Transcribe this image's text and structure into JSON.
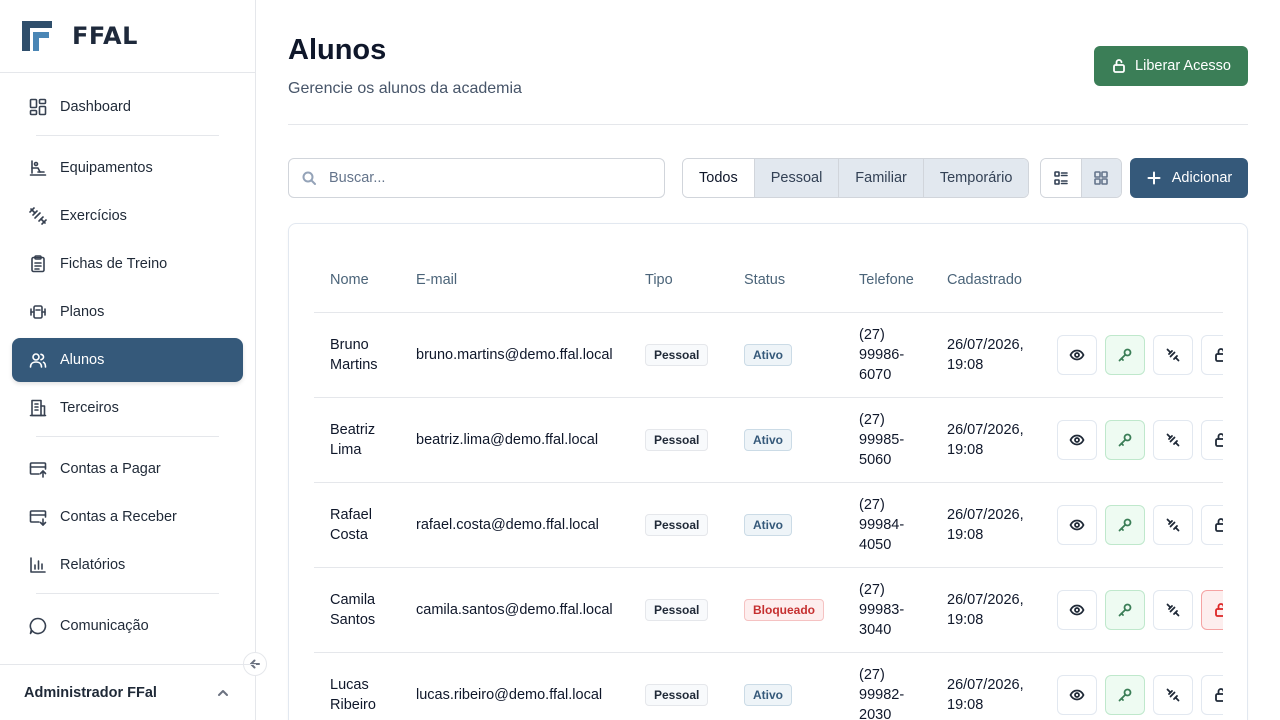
{
  "app": {
    "name": "FFAL"
  },
  "sidebar": {
    "items": [
      {
        "label": "Dashboard",
        "icon": "dashboard-icon"
      },
      {
        "label": "Equipamentos",
        "icon": "equipment-icon"
      },
      {
        "label": "Exercícios",
        "icon": "exercise-icon"
      },
      {
        "label": "Fichas de Treino",
        "icon": "clipboard-icon"
      },
      {
        "label": "Planos",
        "icon": "plans-icon"
      },
      {
        "label": "Alunos",
        "icon": "users-icon",
        "active": true
      },
      {
        "label": "Terceiros",
        "icon": "building-icon"
      },
      {
        "label": "Contas a Pagar",
        "icon": "payable-icon"
      },
      {
        "label": "Contas a Receber",
        "icon": "receivable-icon"
      },
      {
        "label": "Relatórios",
        "icon": "chart-icon"
      },
      {
        "label": "Comunicação",
        "icon": "chat-icon"
      }
    ],
    "user_name": "Administrador FFal"
  },
  "header": {
    "title": "Alunos",
    "subtitle": "Gerencie os alunos da academia",
    "liberar_label": "Liberar Acesso"
  },
  "toolbar": {
    "search_placeholder": "Buscar...",
    "filters": [
      "Todos",
      "Pessoal",
      "Familiar",
      "Temporário"
    ],
    "active_filter": "Todos",
    "view_mode": "grid",
    "add_label": "Adicionar"
  },
  "table": {
    "columns": [
      "Nome",
      "E-mail",
      "Tipo",
      "Status",
      "Telefone",
      "Cadastrado"
    ],
    "rows": [
      {
        "first": "Bruno",
        "last": "Martins",
        "email": "bruno.martins@demo.ffal.local",
        "type": "Pessoal",
        "status": "Ativo",
        "phone": [
          "(27)",
          "99986-",
          "6070"
        ],
        "date": "26/07/2026,",
        "time": "19:08"
      },
      {
        "first": "Beatriz",
        "last": "Lima",
        "email": "beatriz.lima@demo.ffal.local",
        "type": "Pessoal",
        "status": "Ativo",
        "phone": [
          "(27)",
          "99985-",
          "5060"
        ],
        "date": "26/07/2026,",
        "time": "19:08"
      },
      {
        "first": "Rafael",
        "last": "Costa",
        "email": "rafael.costa@demo.ffal.local",
        "type": "Pessoal",
        "status": "Ativo",
        "phone": [
          "(27)",
          "99984-",
          "4050"
        ],
        "date": "26/07/2026,",
        "time": "19:08"
      },
      {
        "first": "Camila",
        "last": "Santos",
        "email": "camila.santos@demo.ffal.local",
        "type": "Pessoal",
        "status": "Bloqueado",
        "phone": [
          "(27)",
          "99983-",
          "3040"
        ],
        "date": "26/07/2026,",
        "time": "19:08"
      },
      {
        "first": "Lucas",
        "last": "Ribeiro",
        "email": "lucas.ribeiro@demo.ffal.local",
        "type": "Pessoal",
        "status": "Ativo",
        "phone": [
          "(27)",
          "99982-",
          "2030"
        ],
        "date": "26/07/2026,",
        "time": "19:08"
      }
    ]
  },
  "colors": {
    "primary": "#35597a",
    "success": "#3b7e57",
    "danger": "#dc2626"
  }
}
